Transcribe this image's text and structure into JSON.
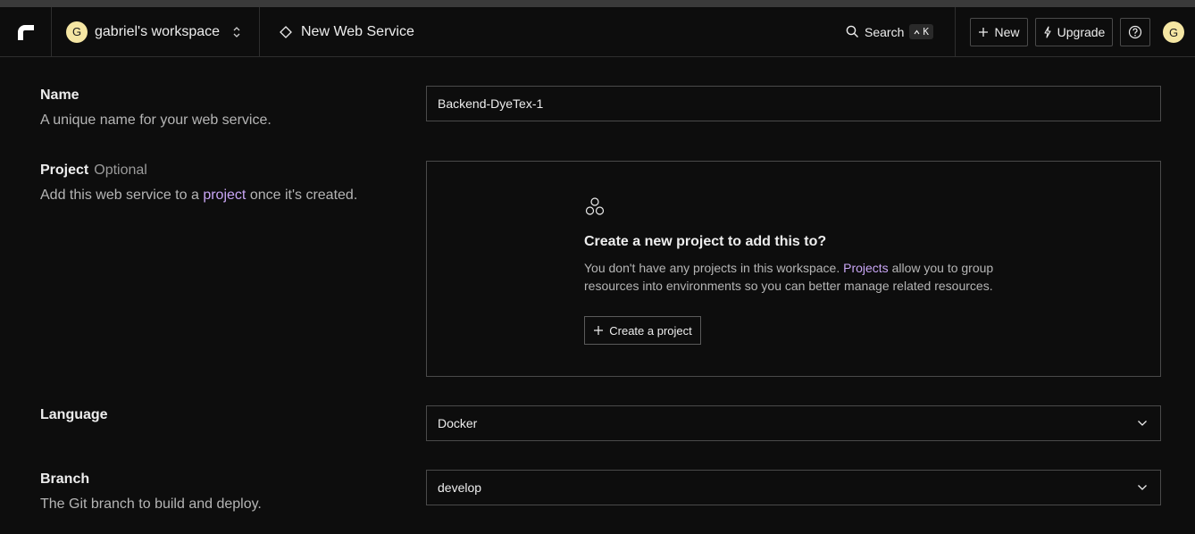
{
  "header": {
    "workspace_initial": "G",
    "workspace_name": "gabriel's workspace",
    "page_title": "New Web Service",
    "search_label": "Search",
    "search_shortcut_key": "K",
    "new_label": "New",
    "upgrade_label": "Upgrade",
    "user_initial": "G"
  },
  "form": {
    "name": {
      "label": "Name",
      "description": "A unique name for your web service.",
      "value": "Backend-DyeTex-1"
    },
    "project": {
      "label": "Project",
      "optional": "Optional",
      "description_pre": "Add this web service to a",
      "description_link": "project",
      "description_post": "once it's created.",
      "panel": {
        "title": "Create a new project to add this to?",
        "text_pre": "You don't have any projects in this workspace.",
        "text_link": "Projects",
        "text_post": "allow you to group resources into environments so you can better manage related resources.",
        "button_label": "Create a project"
      }
    },
    "language": {
      "label": "Language",
      "value": "Docker"
    },
    "branch": {
      "label": "Branch",
      "description": "The Git branch to build and deploy.",
      "value": "develop"
    }
  },
  "colors": {
    "background": "#0d0d0d",
    "link": "#c9a6f5",
    "avatar": "#f5e6a3",
    "border": "#4a4a4a"
  }
}
